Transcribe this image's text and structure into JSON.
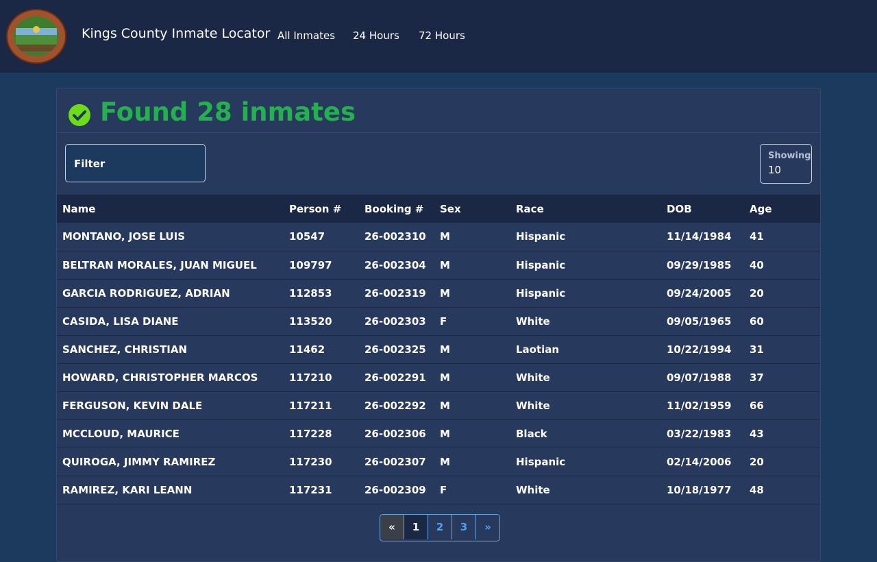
{
  "navbar": {
    "brand": "Kings County Inmate Locator",
    "links": [
      "All Inmates",
      "24 Hours",
      "72 Hours"
    ],
    "seal_text": "COUNTY OF KINGS CALIFORNIA"
  },
  "header": {
    "title": "Found 28 inmates"
  },
  "filter": {
    "label": "Filter"
  },
  "showing": {
    "label": "Showing",
    "value": "10"
  },
  "table": {
    "columns": [
      "Name",
      "Person #",
      "Booking #",
      "Sex",
      "Race",
      "DOB",
      "Age"
    ],
    "rows": [
      [
        "MONTANO, JOSE LUIS",
        "10547",
        "26-002310",
        "M",
        "Hispanic",
        "11/14/1984",
        "41"
      ],
      [
        "BELTRAN MORALES, JUAN MIGUEL",
        "109797",
        "26-002304",
        "M",
        "Hispanic",
        "09/29/1985",
        "40"
      ],
      [
        "GARCIA RODRIGUEZ, ADRIAN",
        "112853",
        "26-002319",
        "M",
        "Hispanic",
        "09/24/2005",
        "20"
      ],
      [
        "CASIDA, LISA DIANE",
        "113520",
        "26-002303",
        "F",
        "White",
        "09/05/1965",
        "60"
      ],
      [
        "SANCHEZ, CHRISTIAN",
        "11462",
        "26-002325",
        "M",
        "Laotian",
        "10/22/1994",
        "31"
      ],
      [
        "HOWARD, CHRISTOPHER MARCOS",
        "117210",
        "26-002291",
        "M",
        "White",
        "09/07/1988",
        "37"
      ],
      [
        "FERGUSON, KEVIN DALE",
        "117211",
        "26-002292",
        "M",
        "White",
        "11/02/1959",
        "66"
      ],
      [
        "MCCLOUD, MAURICE",
        "117228",
        "26-002306",
        "M",
        "Black",
        "03/22/1983",
        "43"
      ],
      [
        "QUIROGA, JIMMY RAMIREZ",
        "117230",
        "26-002307",
        "M",
        "Hispanic",
        "02/14/2006",
        "20"
      ],
      [
        "RAMIREZ, KARI LEANN",
        "117231",
        "26-002309",
        "F",
        "White",
        "10/18/1977",
        "48"
      ]
    ]
  },
  "pagination": {
    "prev": "«",
    "pages": [
      "1",
      "2",
      "3"
    ],
    "next": "»",
    "current": "1"
  },
  "colors": {
    "success": "#22b14c",
    "navbar_bg": "#1a2845",
    "card_bg": "#27395d",
    "page_bg": "#1c3a5e",
    "link": "#4fa3f7"
  }
}
